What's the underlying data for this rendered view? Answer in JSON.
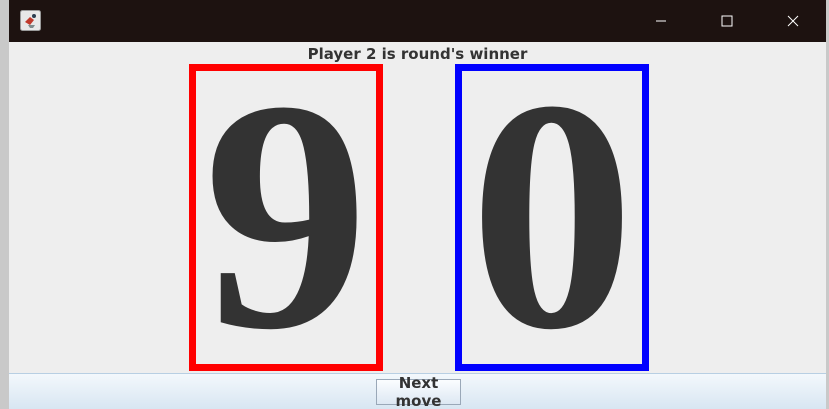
{
  "window": {
    "app_icon": "java-cup-icon",
    "controls": {
      "minimize_icon": "minimize-icon",
      "maximize_icon": "maximize-icon",
      "close_icon": "close-icon"
    }
  },
  "status_text": "Player 2 is round's winner",
  "cards": [
    {
      "digit": "9",
      "border_color": "#ff0000"
    },
    {
      "digit": "0",
      "border_color": "#0000ff"
    }
  ],
  "next_button_label": "Next move",
  "colors": {
    "titlebar": "#1d1210",
    "background": "#eeeeee",
    "text": "#333333"
  }
}
